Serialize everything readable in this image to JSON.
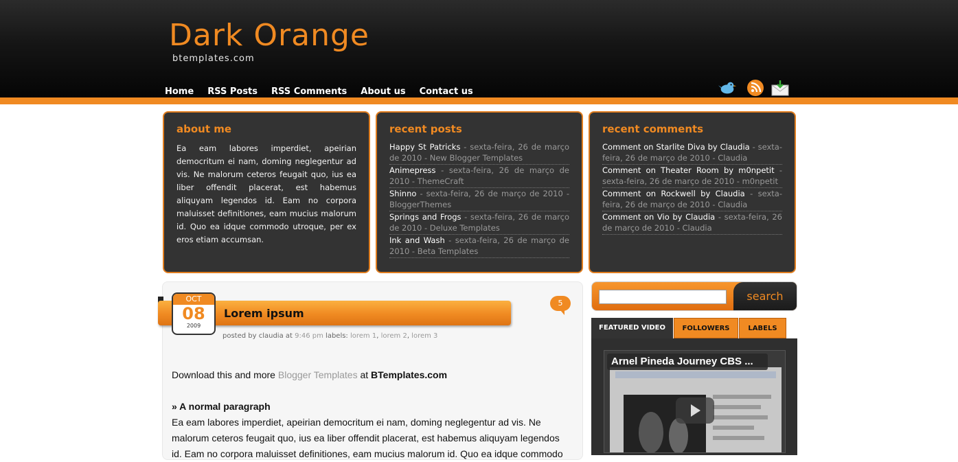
{
  "header": {
    "title": "Dark Orange",
    "subtitle": "btemplates.com",
    "nav": [
      "Home",
      "RSS Posts",
      "RSS Comments",
      "About us",
      "Contact us"
    ]
  },
  "widgets": {
    "about": {
      "title": "about me",
      "text": "Ea eam labores imperdiet, apeirian democritum ei nam, doming neglegentur ad vis. Ne malorum ceteros feugait quo, ius ea liber offendit placerat, est habemus aliquyam legendos id. Eam no corpora maluisset definitiones, eam mucius malorum id. Quo ea idque commodo utroque, per ex eros etiam accumsan."
    },
    "recent_posts": {
      "title": "recent posts",
      "items": [
        {
          "title": "Happy St Patricks",
          "meta": " - sexta-feira, 26 de março de 2010 - New Blogger Templates"
        },
        {
          "title": "Animepress",
          "meta": " - sexta-feira, 26 de março de 2010 - ThemeCraft"
        },
        {
          "title": "Shinno",
          "meta": " - sexta-feira, 26 de março de 2010 - BloggerThemes"
        },
        {
          "title": "Springs and Frogs",
          "meta": " - sexta-feira, 26 de março de 2010 - Deluxe Templates"
        },
        {
          "title": "Ink and Wash",
          "meta": " - sexta-feira, 26 de março de 2010 - Beta Templates"
        }
      ]
    },
    "recent_comments": {
      "title": "recent comments",
      "items": [
        {
          "title": "Comment on Starlite Diva by Claudia",
          "meta": " - sexta-feira, 26 de março de 2010 - Claudia"
        },
        {
          "title": "Comment on Theater Room by m0npetit",
          "meta": " - sexta-feira, 26 de março de 2010 - m0npetit"
        },
        {
          "title": "Comment on Rockwell by Claudia",
          "meta": " - sexta-feira, 26 de março de 2010 - Claudia"
        },
        {
          "title": "Comment on Vio by Claudia",
          "meta": " - sexta-feira, 26 de março de 2010 - Claudia"
        }
      ]
    }
  },
  "post": {
    "month": "OCT",
    "day": "08",
    "year": "2009",
    "title": "Lorem ipsum",
    "comments": "5",
    "posted_by": "posted by claudia at ",
    "time": "9:46 pm",
    "labels_prefix": " labels: ",
    "labels": [
      "lorem 1",
      "lorem 2",
      "lorem 3"
    ],
    "intro_prefix": "Download this and more ",
    "intro_link": "Blogger Templates",
    "intro_mid": " at ",
    "intro_site": "BTemplates.com",
    "section_heading": "» A normal paragraph",
    "paragraph": "Ea eam labores imperdiet, apeirian democritum ei nam, doming neglegentur ad vis. Ne malorum ceteros feugait quo, ius ea liber offendit placerat, est habemus aliquyam legendos id. Eam no corpora maluisset definitiones, eam mucius malorum id. Quo ea idque commodo"
  },
  "sidebar": {
    "search_label": "search",
    "tabs": [
      "FEATURED VIDEO",
      "FOLLOWERS",
      "LABELS"
    ],
    "video_title": "Arnel Pineda Journey CBS ..."
  },
  "colors": {
    "accent": "#f08a22",
    "dark": "#333333"
  }
}
